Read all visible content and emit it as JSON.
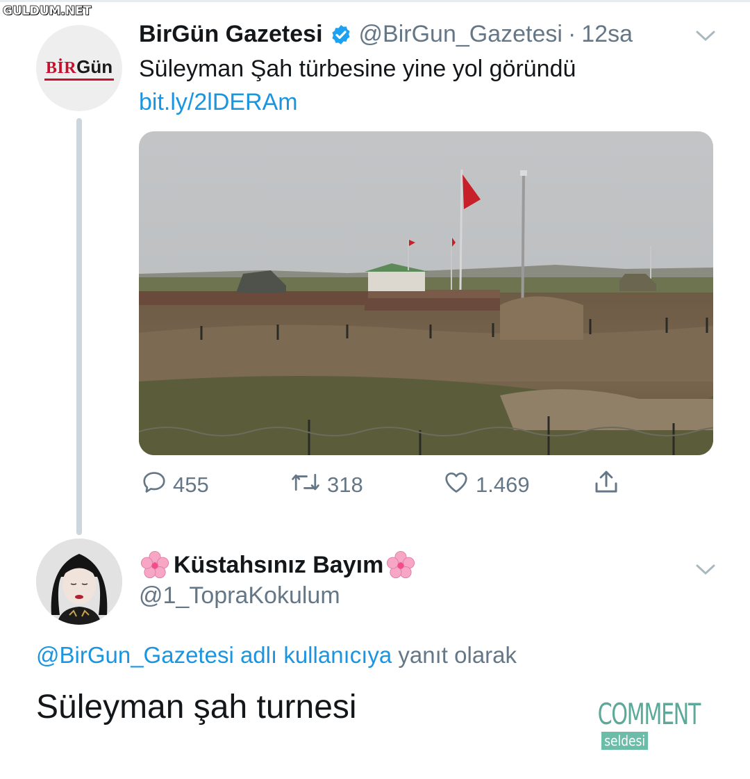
{
  "watermark": "GULDUM.NET",
  "tweet": {
    "author_name": "BirGün Gazetesi",
    "author_handle": "@BirGun_Gazetesi",
    "separator": "·",
    "time": "12sa",
    "avatar_logo": {
      "part1": "BİR",
      "part2": "Gün"
    },
    "text": "Süleyman Şah türbesine yine yol göründü",
    "link": "bit.ly/2lDERAm",
    "counts": {
      "replies": "455",
      "retweets": "318",
      "likes": "1.469"
    }
  },
  "reply": {
    "author_name": "Küstahsınız Bayım",
    "author_handle": "@1_TopraKokulum",
    "replying_to_mention": "@BirGun_Gazetesi adlı kullanıcıya",
    "replying_to_suffix": "yanıt olarak",
    "text": "Süleyman şah turnesi"
  },
  "badge": {
    "line1": "COMMENT",
    "line2": "seldesi"
  },
  "colors": {
    "link": "#1b95e0",
    "muted": "#657786",
    "verified": "#1da1f2",
    "text": "#14171a"
  }
}
